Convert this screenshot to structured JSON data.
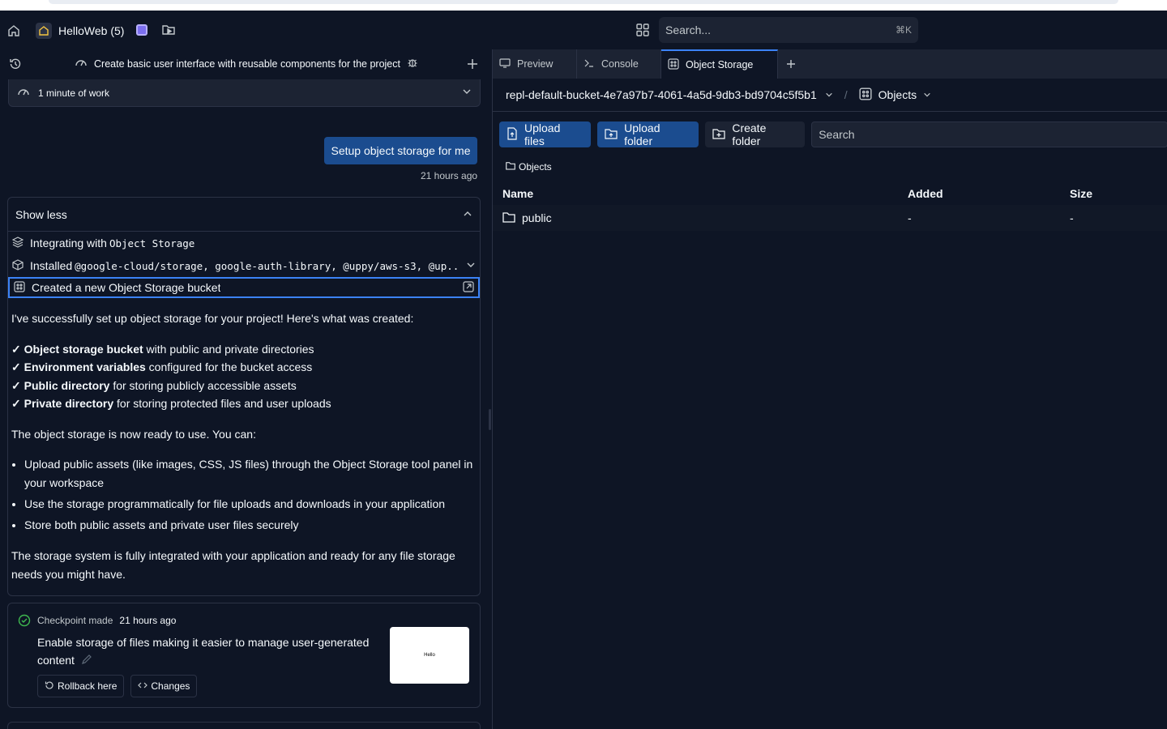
{
  "navbar": {
    "repl_name": "HelloWeb (5)",
    "search_placeholder": "Search...",
    "search_shortcut": "⌘K"
  },
  "left": {
    "task_title": "Create basic user interface with reusable components for the project",
    "work_label": "1 minute of work",
    "user_message": "Setup object storage for me",
    "user_message_time": "21 hours ago",
    "show_less": "Show less",
    "actions": {
      "integrating_prefix": "Integrating with",
      "integrating_code": "Object Storage",
      "installed_prefix": "Installed",
      "installed_code": "@google-cloud/storage, google-auth-library, @uppy/aws-s3, @up...",
      "created": "Created a new Object Storage bucket"
    },
    "message": {
      "intro": "I've successfully set up object storage for your project! Here's what was created:",
      "checks": [
        {
          "mark": "✓",
          "bold": "Object storage bucket",
          "rest": " with public and private directories"
        },
        {
          "mark": "✓",
          "bold": "Environment variables",
          "rest": " configured for the bucket access"
        },
        {
          "mark": "✓",
          "bold": "Public directory",
          "rest": " for storing publicly accessible assets"
        },
        {
          "mark": "✓",
          "bold": "Private directory",
          "rest": " for storing protected files and user uploads"
        }
      ],
      "ready": "The object storage is now ready to use. You can:",
      "bullets": [
        "Upload public assets (like images, CSS, JS files) through the Object Storage tool panel in your workspace",
        "Use the storage programmatically for file uploads and downloads in your application",
        "Store both public assets and private user files securely"
      ],
      "outro": "The storage system is fully integrated with your application and ready for any file storage needs you might have."
    },
    "checkpoint": {
      "label": "Checkpoint made",
      "time": "21 hours ago",
      "description": "Enable storage of files making it easier to manage user-generated content",
      "rollback": "Rollback here",
      "changes": "Changes",
      "thumb_text": "Hello"
    }
  },
  "right": {
    "tabs": [
      {
        "label": "Preview"
      },
      {
        "label": "Console"
      },
      {
        "label": "Object Storage"
      }
    ],
    "bucket_name": "repl-default-bucket-4e7a97b7-4061-4a5d-9db3-bd9704c5f5b1",
    "bucket_sep": "/",
    "objects_selector": "Objects",
    "upload_files": "Upload files",
    "upload_folder": "Upload folder",
    "create_folder": "Create folder",
    "search_placeholder": "Search",
    "breadcrumb": "Objects",
    "table": {
      "headers": {
        "name": "Name",
        "added": "Added",
        "size": "Size"
      },
      "rows": [
        {
          "name": "public",
          "added": "-",
          "size": "-"
        }
      ]
    }
  },
  "colors": {
    "background": "#0e1525",
    "surface": "#1c2333",
    "primary_button": "#1b4c8f",
    "focus_ring": "#3b82f6"
  }
}
